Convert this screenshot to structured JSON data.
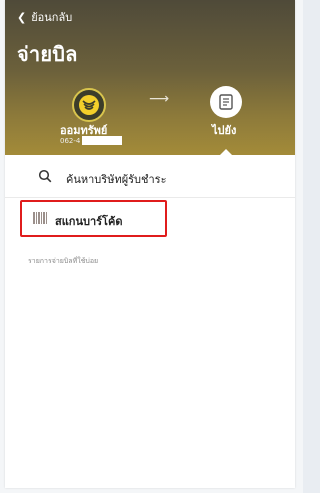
{
  "header": {
    "back_label": "ย้อนกลับ",
    "title": "จ่ายบิล",
    "from_account_name": "ออมทรัพย์",
    "from_account_number": "062-4",
    "to_label": "ไปยัง"
  },
  "search": {
    "label": "ค้นหาบริษัทผู้รับชำระ"
  },
  "scan": {
    "label": "สแกนบาร์โค้ด"
  },
  "frequent": {
    "label": "รายการจ่ายบิลที่ใช้บ่อย"
  },
  "icons": {
    "back": "chevron-left-icon",
    "bank_logo": "krungsri-logo-icon",
    "arrow": "arrow-right-icon",
    "bill": "bill-document-icon",
    "search": "search-icon",
    "barcode": "barcode-icon"
  },
  "colors": {
    "highlight_border": "#e01c1c",
    "header_gold": "#a38b39"
  }
}
